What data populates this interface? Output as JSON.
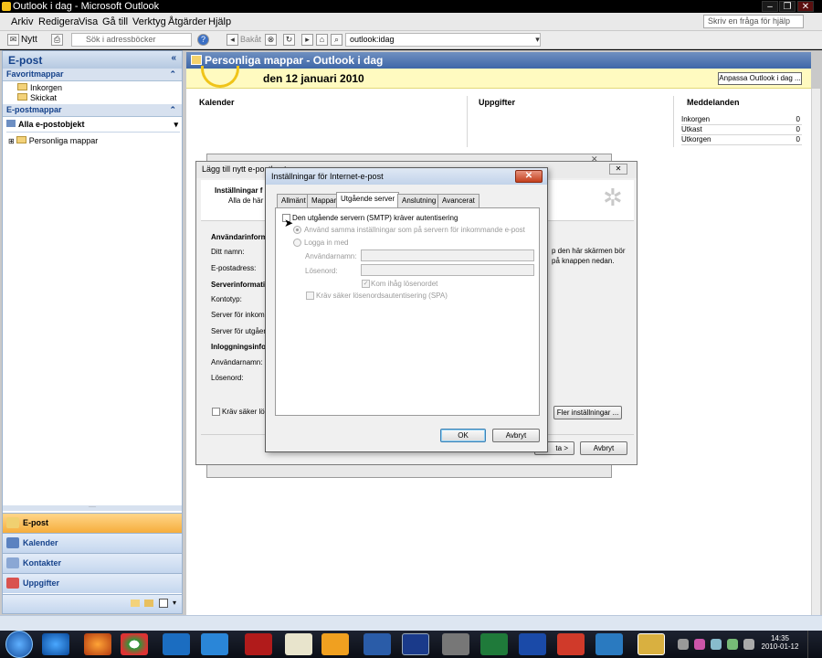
{
  "window": {
    "title": "Outlook i dag - Microsoft Outlook"
  },
  "menu": [
    "Arkiv",
    "Redigera",
    "Visa",
    "Gå till",
    "Verktyg",
    "Åtgärder",
    "Hjälp"
  ],
  "help_search": {
    "placeholder": "Skriv en fråga för hjälp"
  },
  "toolbar": {
    "new_label": "Nytt",
    "address_search_placeholder": "Sök i adressböcker",
    "back_label": "Bakåt",
    "url_value": "outlook:idag"
  },
  "nav": {
    "header": "E-post",
    "favorites_title": "Favoritmappar",
    "favorites": [
      "Inkorgen",
      "Skickat"
    ],
    "mail_folders_title": "E-postmappar",
    "all_items": "Alla e-postobjekt",
    "personal_folders": "Personliga mappar",
    "buttons": [
      "E-post",
      "Kalender",
      "Kontakter",
      "Uppgifter"
    ]
  },
  "content": {
    "header": "Personliga mappar - Outlook i dag",
    "date": "den 12 januari 2010",
    "customize_button": "Anpassa Outlook i dag ...",
    "columns": [
      "Kalender",
      "Uppgifter",
      "Meddelanden"
    ],
    "messages": [
      {
        "name": "Inkorgen",
        "count": "0"
      },
      {
        "name": "Utkast",
        "count": "0"
      },
      {
        "name": "Utkorgen",
        "count": "0"
      }
    ]
  },
  "wizard": {
    "title": "Lägg till nytt e-postkonto",
    "heading": "Inställningar f",
    "subheading": "Alla de här i",
    "side_text_1": "p den här skärmen bör",
    "side_text_2": "på knappen nedan.",
    "user_info": "Användarinform",
    "your_name": "Ditt namn:",
    "email_address": "E-postadress:",
    "server_info": "Serverinformati",
    "account_type": "Kontotyp:",
    "incoming_server": "Server för inkomm",
    "outgoing_server": "Server för utgåen",
    "login_info": "Inloggningsinfo",
    "username": "Användarnamn:",
    "password": "Lösenord:",
    "require_spa": "Kräv säker lösen",
    "more_settings": "Fler inställningar ...",
    "next_button": "ta >",
    "cancel_button": "Avbryt"
  },
  "settings_dialog": {
    "title": "Inställningar för Internet-e-post",
    "tabs": [
      "Allmänt",
      "Mappar",
      "Utgående server",
      "Anslutning",
      "Avancerat"
    ],
    "selected_tab": "Utgående server",
    "smtp_auth": "Den utgående servern (SMTP) kräver autentisering",
    "use_same_settings": "Använd samma inställningar som på servern för inkommande e-post",
    "log_in_with": "Logga in med",
    "username_label": "Användarnamn:",
    "password_label": "Lösenord:",
    "remember_password": "Kom ihåg lösenordet",
    "require_spa": "Kräv säker lösenordsautentisering (SPA)",
    "ok": "OK",
    "cancel": "Avbryt"
  },
  "taskbar": {
    "time": "14:35",
    "date": "2010-01-12"
  },
  "colors": {
    "accent": "#3e67a8",
    "active_nav": "#f6ad3c",
    "date_bar": "#fffac0"
  }
}
